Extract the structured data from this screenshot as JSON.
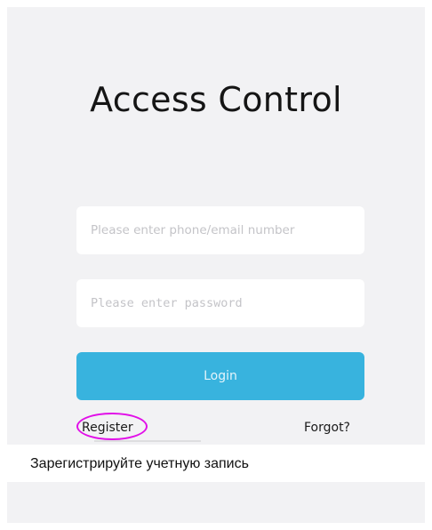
{
  "login_screen": {
    "title": "Access Control",
    "username_placeholder": "Please enter phone/email number",
    "password_placeholder": "Please enter password",
    "login_label": "Login",
    "register_label": "Register",
    "forgot_label": "Forgot?"
  },
  "annotation": {
    "caption": "Зарегистрируйте учетную запись",
    "highlight_color": "#e10fe8"
  },
  "colors": {
    "accent": "#38b3de",
    "screen_background": "#f2f2f4"
  }
}
